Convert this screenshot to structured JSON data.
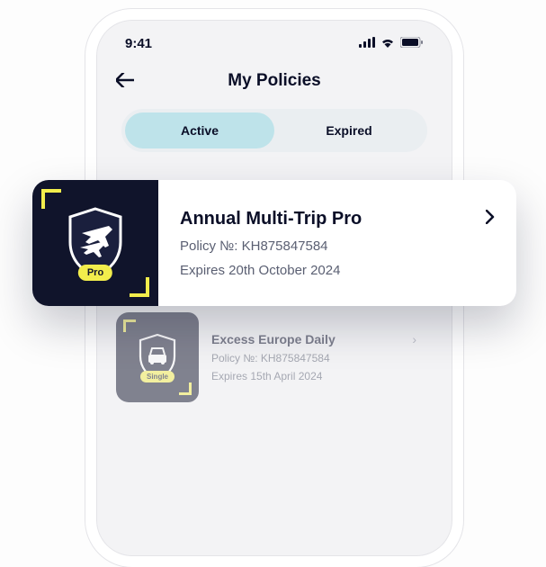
{
  "status": {
    "time": "9:41"
  },
  "header": {
    "title": "My Policies"
  },
  "tabs": {
    "active": "Active",
    "expired": "Expired"
  },
  "float_card": {
    "badge": "Pro",
    "title": "Annual Multi-Trip Pro",
    "policy_label": "Policy №: KH875847584",
    "expiry": "Expires 20th October 2024"
  },
  "bg_card": {
    "badge": "Single",
    "title": "Excess Europe Daily",
    "policy_label": "Policy №: KH875847584",
    "expiry": "Expires 15th April 2024"
  }
}
